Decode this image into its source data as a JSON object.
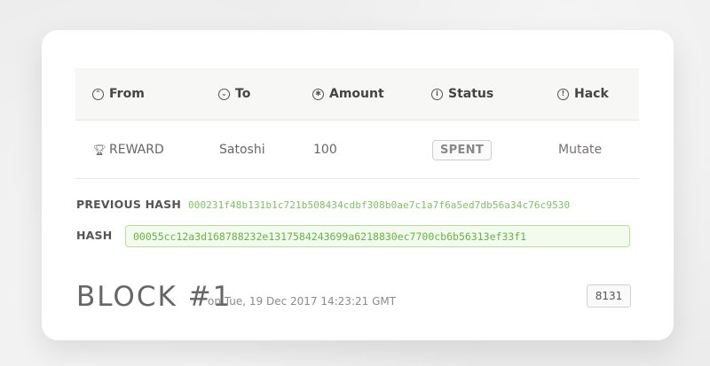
{
  "table": {
    "headers": [
      {
        "icon": "chevron-up-circle-icon",
        "glyph": "⌃",
        "label": "From"
      },
      {
        "icon": "chevron-down-circle-icon",
        "glyph": "⌄",
        "label": "To"
      },
      {
        "icon": "asterisk-circle-icon",
        "glyph": "✱",
        "label": "Amount"
      },
      {
        "icon": "info-circle-icon",
        "glyph": "i",
        "label": "Status"
      },
      {
        "icon": "alert-circle-icon",
        "glyph": "!",
        "label": "Hack"
      }
    ],
    "row": {
      "from_icon": "trophy-icon",
      "from": "REWARD",
      "to": "Satoshi",
      "amount": "100",
      "status": "SPENT",
      "hack": "Mutate"
    }
  },
  "previous_hash": {
    "label": "PREVIOUS HASH",
    "value": "000231f48b131b1c721b508434cdbf308b0ae7c1a7f6a5ed7db56a34c76c9530"
  },
  "hash": {
    "label": "HASH",
    "value": "00055cc12a3d168788232e1317584243699a6218830ec7700cb6b56313ef33f1"
  },
  "block": {
    "title": "BLOCK #1",
    "timestamp": "on Tue, 19 Dec 2017 14:23:21 GMT",
    "nonce": "8131"
  },
  "colors": {
    "hash_green": "#67b444",
    "prev_hash_green": "#7cc35f"
  }
}
